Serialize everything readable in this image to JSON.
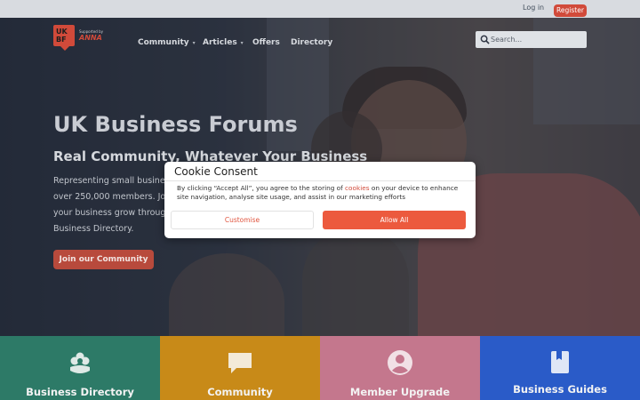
{
  "topbar": {
    "login": "Log in",
    "register": "Register"
  },
  "brand": {
    "logo_text": "UK BF",
    "sub": "Supported by",
    "anna": "ANNA"
  },
  "nav": {
    "items": [
      {
        "label": "Community",
        "has_dropdown": true
      },
      {
        "label": "Articles",
        "has_dropdown": true
      },
      {
        "label": "Offers",
        "has_dropdown": false
      },
      {
        "label": "Directory",
        "has_dropdown": false
      }
    ]
  },
  "search": {
    "placeholder": "Search..."
  },
  "hero": {
    "title": "UK Business Forums",
    "subtitle": "Real Community, Whatever Your Business",
    "lines": [
      "Representing small business",
      "over 250,000 members. Join",
      "your business grow through",
      "Business Directory."
    ],
    "cta": "Join our Community"
  },
  "cookie": {
    "title": "Cookie Consent",
    "text_before": "By clicking “Accept All”, you agree to the storing of ",
    "link": "cookies",
    "text_after": " on your device to enhance site navigation, analyse site usage, and assist in our marketing efforts",
    "customise": "Customise",
    "allow": "Allow All"
  },
  "tiles": [
    {
      "label": "Business Directory",
      "icon": "flower-icon",
      "color": "#2d7a67"
    },
    {
      "label": "Community",
      "icon": "chat-icon",
      "color": "#c88a18"
    },
    {
      "label": "Member Upgrade",
      "icon": "user-icon",
      "color": "#c4778d"
    },
    {
      "label": "Business Guides",
      "icon": "book-icon",
      "color": "#2a5bc8"
    }
  ],
  "colors": {
    "brand": "#d14a3a",
    "allow": "#ec5a3e"
  }
}
